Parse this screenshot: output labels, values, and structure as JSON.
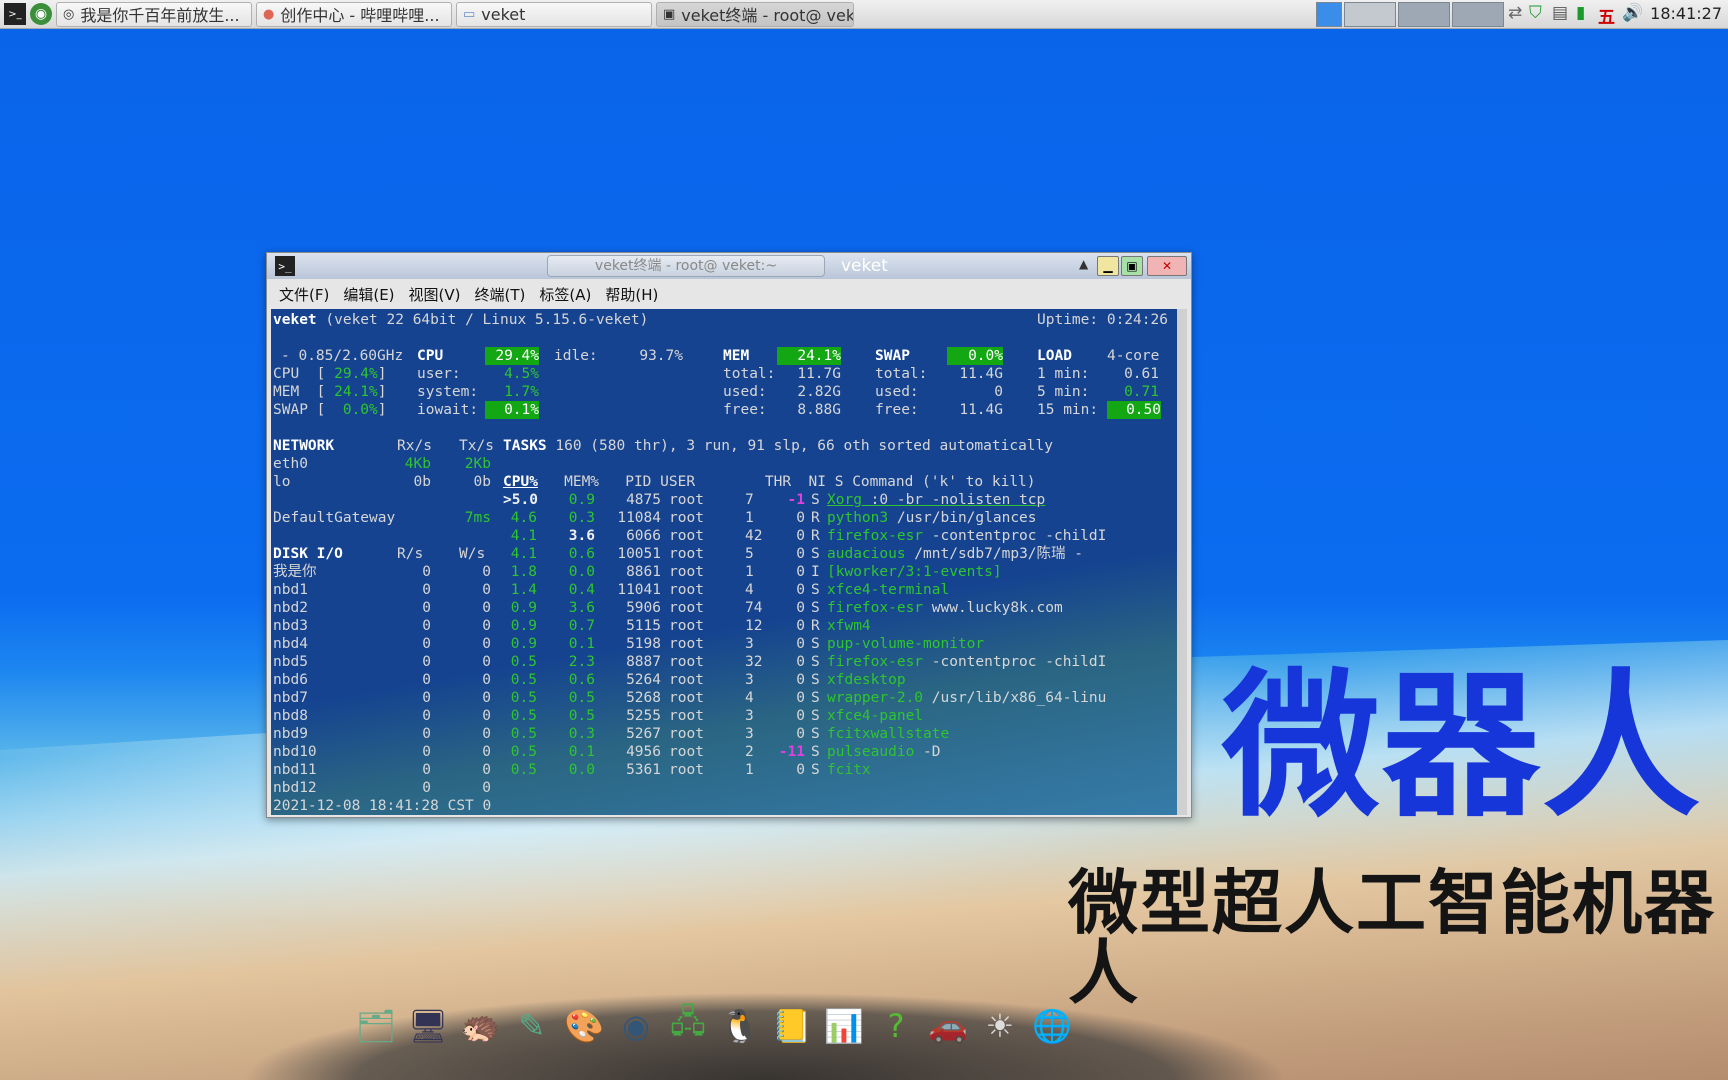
{
  "taskbar": {
    "tasks": [
      {
        "label": "我是你千百年前放生..."
      },
      {
        "label": "创作中心 - 哔哩哔哩..."
      },
      {
        "label": "veket"
      },
      {
        "label": "veket终端 - root@ vek…"
      }
    ],
    "tray_day": "五",
    "clock": "18:41:27"
  },
  "desktop": {
    "watermark_title": "微器人",
    "watermark_subtitle": "微型超人工智能机器人"
  },
  "window": {
    "tab_title": "veket终端 - root@ veket:~",
    "title": "veket",
    "menu": [
      "文件(F)",
      "编辑(E)",
      "视图(V)",
      "终端(T)",
      "标签(A)",
      "帮助(H)"
    ]
  },
  "glances": {
    "host": "veket",
    "sysinfo": "(veket 22 64bit / Linux 5.15.6-veket)",
    "uptime": "Uptime: 0:24:26",
    "cpu_freq": "- 0.85/2.60GHz",
    "cpu_total": "29.4%",
    "cpu_idle": "93.7%",
    "cpu_user": "4.5%",
    "cpu_system": "1.7%",
    "cpu_iowait": "0.1%",
    "quick": {
      "cpu": "29.4%",
      "mem": "24.1%",
      "swap": "0.0%"
    },
    "mem": {
      "percent": "24.1%",
      "total": "11.7G",
      "used": "2.82G",
      "free": "8.88G"
    },
    "swap": {
      "percent": "0.0%",
      "total": "11.4G",
      "used": "0",
      "free": "11.4G"
    },
    "load": {
      "cores": "4-core",
      "1min": "0.61",
      "5min": "0.71",
      "15min": "0.50"
    },
    "network": [
      {
        "iface": "eth0",
        "rx": "4Kb",
        "tx": "2Kb"
      },
      {
        "iface": "lo",
        "rx": "0b",
        "tx": "0b"
      }
    ],
    "gateway": {
      "name": "DefaultGateway",
      "value": "7ms"
    },
    "tasks_line": "160 (580 thr), 3 run, 91 slp, 66 oth sorted automatically",
    "disks": [
      {
        "name": "我是你",
        "r": "0",
        "w": "0"
      },
      {
        "name": "nbd1",
        "r": "0",
        "w": "0"
      },
      {
        "name": "nbd2",
        "r": "0",
        "w": "0"
      },
      {
        "name": "nbd3",
        "r": "0",
        "w": "0"
      },
      {
        "name": "nbd4",
        "r": "0",
        "w": "0"
      },
      {
        "name": "nbd5",
        "r": "0",
        "w": "0"
      },
      {
        "name": "nbd6",
        "r": "0",
        "w": "0"
      },
      {
        "name": "nbd7",
        "r": "0",
        "w": "0"
      },
      {
        "name": "nbd8",
        "r": "0",
        "w": "0"
      },
      {
        "name": "nbd9",
        "r": "0",
        "w": "0"
      },
      {
        "name": "nbd10",
        "r": "0",
        "w": "0"
      },
      {
        "name": "nbd11",
        "r": "0",
        "w": "0"
      },
      {
        "name": "nbd12",
        "r": "0",
        "w": "0"
      }
    ],
    "processes": [
      {
        "cpu": ">5.0",
        "mem": "0.9",
        "pid": "4875",
        "user": "root",
        "thr": "7",
        "ni": "-1",
        "s": "S",
        "cmd": "Xorg",
        "args": ":0 -br -nolisten tcp"
      },
      {
        "cpu": "4.6",
        "mem": "0.3",
        "pid": "11084",
        "user": "root",
        "thr": "1",
        "ni": "0",
        "s": "R",
        "cmd": "python3",
        "args": "/usr/bin/glances"
      },
      {
        "cpu": "4.1",
        "mem": "3.6",
        "pid": "6066",
        "user": "root",
        "thr": "42",
        "ni": "0",
        "s": "R",
        "cmd": "firefox-esr",
        "args": "-contentproc -childI"
      },
      {
        "cpu": "4.1",
        "mem": "0.6",
        "pid": "10051",
        "user": "root",
        "thr": "5",
        "ni": "0",
        "s": "S",
        "cmd": "audacious",
        "args": "/mnt/sdb7/mp3/陈瑞 -"
      },
      {
        "cpu": "1.8",
        "mem": "0.0",
        "pid": "8861",
        "user": "root",
        "thr": "1",
        "ni": "0",
        "s": "I",
        "cmd": "[kworker/3:1-events]",
        "args": ""
      },
      {
        "cpu": "1.4",
        "mem": "0.4",
        "pid": "11041",
        "user": "root",
        "thr": "4",
        "ni": "0",
        "s": "S",
        "cmd": "xfce4-terminal",
        "args": ""
      },
      {
        "cpu": "0.9",
        "mem": "3.6",
        "pid": "5906",
        "user": "root",
        "thr": "74",
        "ni": "0",
        "s": "S",
        "cmd": "firefox-esr",
        "args": "www.lucky8k.com"
      },
      {
        "cpu": "0.9",
        "mem": "0.7",
        "pid": "5115",
        "user": "root",
        "thr": "12",
        "ni": "0",
        "s": "R",
        "cmd": "xfwm4",
        "args": ""
      },
      {
        "cpu": "0.9",
        "mem": "0.1",
        "pid": "5198",
        "user": "root",
        "thr": "3",
        "ni": "0",
        "s": "S",
        "cmd": "pup-volume-monitor",
        "args": ""
      },
      {
        "cpu": "0.5",
        "mem": "2.3",
        "pid": "8887",
        "user": "root",
        "thr": "32",
        "ni": "0",
        "s": "S",
        "cmd": "firefox-esr",
        "args": "-contentproc -childI"
      },
      {
        "cpu": "0.5",
        "mem": "0.6",
        "pid": "5264",
        "user": "root",
        "thr": "3",
        "ni": "0",
        "s": "S",
        "cmd": "xfdesktop",
        "args": ""
      },
      {
        "cpu": "0.5",
        "mem": "0.5",
        "pid": "5268",
        "user": "root",
        "thr": "4",
        "ni": "0",
        "s": "S",
        "cmd": "wrapper-2.0",
        "args": "/usr/lib/x86_64-linu"
      },
      {
        "cpu": "0.5",
        "mem": "0.5",
        "pid": "5255",
        "user": "root",
        "thr": "3",
        "ni": "0",
        "s": "S",
        "cmd": "xfce4-panel",
        "args": ""
      },
      {
        "cpu": "0.5",
        "mem": "0.3",
        "pid": "5267",
        "user": "root",
        "thr": "3",
        "ni": "0",
        "s": "S",
        "cmd": "fcitxwallstate",
        "args": ""
      },
      {
        "cpu": "0.5",
        "mem": "0.1",
        "pid": "4956",
        "user": "root",
        "thr": "2",
        "ni": "-11",
        "s": "S",
        "cmd": "pulseaudio",
        "args": "-D"
      },
      {
        "cpu": "0.5",
        "mem": "0.0",
        "pid": "5361",
        "user": "root",
        "thr": "1",
        "ni": "0",
        "s": "S",
        "cmd": "fcitx",
        "args": ""
      }
    ],
    "timestamp": "2021-12-08 18:41:28 CST 0"
  },
  "dock_icons": [
    "home-folder-icon",
    "monitor-icon",
    "hedgehog-icon",
    "drawing-icon",
    "paint-palette-icon",
    "media-player-icon",
    "network-icon",
    "penguin-icon",
    "notebook-icon",
    "chart-icon",
    "help-icon",
    "car-icon",
    "settings-sun-icon",
    "globe-icon"
  ]
}
